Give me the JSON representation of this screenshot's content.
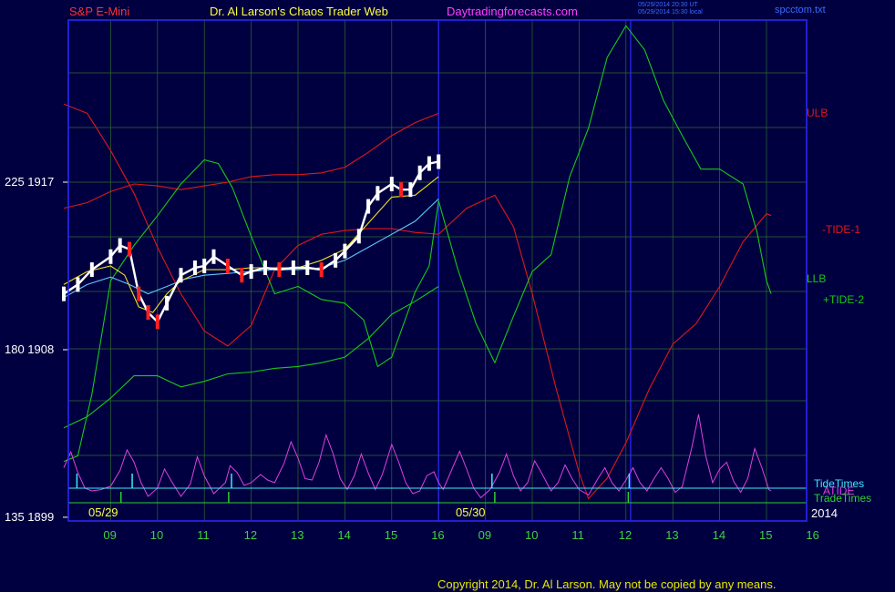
{
  "header": {
    "symbol": "S&P E-Mini",
    "title": "Dr. Al Larson's Chaos Trader Web",
    "site": "Daytradingforecasts.com",
    "stamp_ut": "05/29/2014 20:30 UT",
    "stamp_local": "05/29/2014 15:30 local",
    "file": "spcctom.txt"
  },
  "copyright": "Copyright 2014, Dr. Al Larson. May not be copied by any means.",
  "colors": {
    "background": "#000040",
    "grid": "#2e6a2e",
    "frame": "#2a2aff",
    "price": "#ffffff",
    "price_down": "#ff2020",
    "ulb": "#e01818",
    "llb": "#18c818",
    "ma": "#5ec8ff",
    "ma_fast": "#f0e020",
    "tide": "#e040e0",
    "tidetimes": "#40e8ff",
    "tradetimes": "#30d030"
  },
  "chart_data": {
    "type": "line",
    "y_axis_left": {
      "ticks": [
        {
          "value": 1917,
          "label": "225  1917"
        },
        {
          "value": 1908,
          "label": "180  1908"
        },
        {
          "value": 1899,
          "label": "135  1899"
        }
      ],
      "range": [
        1899,
        1925
      ]
    },
    "x_axis": {
      "hour_labels": [
        "09",
        "10",
        "11",
        "12",
        "13",
        "14",
        "15",
        "16",
        "09",
        "10",
        "11",
        "12",
        "13",
        "14",
        "15",
        "16"
      ],
      "date_labels": [
        "05/29",
        "05/30"
      ],
      "year_label": "2014"
    },
    "right_labels": [
      {
        "text": "ULB",
        "color": "#e01818"
      },
      {
        "text": "-TIDE-1",
        "color": "#e01818"
      },
      {
        "text": "LLB",
        "color": "#18c818"
      },
      {
        "text": "+TIDE-2",
        "color": "#18c818"
      },
      {
        "text": "TideTimes",
        "color": "#40e8ff"
      },
      {
        "text": "ATIDE",
        "color": "#e040e0"
      },
      {
        "text": "TradeTimes",
        "color": "#30d030"
      }
    ],
    "series": [
      {
        "key": "ulb",
        "points": [
          [
            8.0,
            1921.2
          ],
          [
            8.5,
            1920.7
          ],
          [
            9.0,
            1918.7
          ],
          [
            9.5,
            1916.4
          ],
          [
            10.0,
            1913.5
          ],
          [
            10.5,
            1911.0
          ],
          [
            11.0,
            1909.0
          ],
          [
            11.5,
            1908.2
          ],
          [
            12.0,
            1909.3
          ],
          [
            12.5,
            1912.3
          ],
          [
            13.0,
            1913.6
          ],
          [
            13.5,
            1914.2
          ],
          [
            14.0,
            1914.4
          ],
          [
            14.5,
            1914.5
          ],
          [
            15.0,
            1914.5
          ],
          [
            15.5,
            1914.3
          ],
          [
            16.0,
            1914.2
          ],
          [
            16.6,
            1915.6
          ],
          [
            17.2,
            1916.3
          ],
          [
            17.6,
            1914.6
          ],
          [
            18.0,
            1911.0
          ],
          [
            18.5,
            1906.0
          ],
          [
            19.0,
            1901.4
          ],
          [
            19.2,
            1900.0
          ],
          [
            19.6,
            1901.1
          ],
          [
            20.0,
            1903.0
          ],
          [
            20.5,
            1905.9
          ],
          [
            21.0,
            1908.3
          ],
          [
            21.5,
            1909.4
          ],
          [
            22.0,
            1911.4
          ],
          [
            22.5,
            1913.8
          ],
          [
            23.0,
            1915.3
          ],
          [
            23.1,
            1915.2
          ]
        ]
      },
      {
        "key": "ulb",
        "points": [
          [
            8.0,
            1915.6
          ],
          [
            8.5,
            1915.9
          ],
          [
            9.0,
            1916.5
          ],
          [
            9.5,
            1916.9
          ],
          [
            10.0,
            1916.8
          ],
          [
            10.5,
            1916.6
          ],
          [
            11.0,
            1916.8
          ],
          [
            11.5,
            1917.0
          ],
          [
            12.0,
            1917.3
          ],
          [
            12.5,
            1917.4
          ],
          [
            13.0,
            1917.4
          ],
          [
            13.5,
            1917.5
          ],
          [
            14.0,
            1917.8
          ],
          [
            14.5,
            1918.6
          ],
          [
            15.0,
            1919.5
          ],
          [
            15.5,
            1920.2
          ],
          [
            16.0,
            1920.7
          ]
        ]
      },
      {
        "key": "llb",
        "points": [
          [
            8.0,
            1903.8
          ],
          [
            8.5,
            1904.4
          ],
          [
            9.0,
            1905.4
          ],
          [
            9.5,
            1906.6
          ],
          [
            10.0,
            1906.6
          ],
          [
            10.5,
            1906.0
          ],
          [
            11.0,
            1906.3
          ],
          [
            11.5,
            1906.7
          ],
          [
            12.0,
            1906.8
          ],
          [
            12.5,
            1907.0
          ],
          [
            13.0,
            1907.1
          ],
          [
            13.5,
            1907.3
          ],
          [
            14.0,
            1907.6
          ],
          [
            14.5,
            1908.6
          ],
          [
            15.0,
            1909.9
          ],
          [
            15.5,
            1910.6
          ],
          [
            16.0,
            1911.4
          ]
        ]
      },
      {
        "key": "llb",
        "points": [
          [
            8.0,
            1902.0
          ],
          [
            8.3,
            1902.3
          ],
          [
            8.6,
            1905.6
          ],
          [
            9.0,
            1911.7
          ],
          [
            9.5,
            1913.6
          ],
          [
            10.0,
            1915.2
          ],
          [
            10.5,
            1916.9
          ],
          [
            11.0,
            1918.2
          ],
          [
            11.3,
            1918.0
          ],
          [
            11.6,
            1916.7
          ],
          [
            12.0,
            1914.1
          ],
          [
            12.5,
            1911.0
          ],
          [
            13.0,
            1911.4
          ],
          [
            13.5,
            1910.7
          ],
          [
            14.0,
            1910.5
          ],
          [
            14.4,
            1909.6
          ],
          [
            14.7,
            1907.1
          ],
          [
            15.0,
            1907.6
          ],
          [
            15.5,
            1911.1
          ],
          [
            15.8,
            1912.5
          ],
          [
            16.0,
            1916.0
          ],
          [
            16.4,
            1912.4
          ],
          [
            16.8,
            1909.4
          ],
          [
            17.2,
            1907.3
          ],
          [
            17.6,
            1909.8
          ],
          [
            18.0,
            1912.2
          ],
          [
            18.4,
            1913.1
          ],
          [
            18.8,
            1917.3
          ],
          [
            19.2,
            1919.9
          ],
          [
            19.6,
            1923.7
          ],
          [
            20.0,
            1925.4
          ],
          [
            20.4,
            1924.1
          ],
          [
            20.8,
            1921.4
          ],
          [
            21.2,
            1919.5
          ],
          [
            21.6,
            1917.7
          ],
          [
            22.0,
            1917.7
          ],
          [
            22.5,
            1916.9
          ],
          [
            22.8,
            1914.3
          ],
          [
            23.0,
            1911.7
          ],
          [
            23.1,
            1911.0
          ]
        ]
      },
      {
        "key": "ma",
        "points": [
          [
            8.0,
            1910.8
          ],
          [
            8.5,
            1911.5
          ],
          [
            9.0,
            1911.9
          ],
          [
            9.4,
            1911.5
          ],
          [
            9.8,
            1911.0
          ],
          [
            10.2,
            1911.4
          ],
          [
            10.6,
            1911.8
          ],
          [
            11.0,
            1912.0
          ],
          [
            11.5,
            1912.1
          ],
          [
            12.0,
            1912.2
          ],
          [
            12.5,
            1912.3
          ],
          [
            13.0,
            1912.3
          ],
          [
            13.5,
            1912.4
          ],
          [
            14.0,
            1912.8
          ],
          [
            14.5,
            1913.5
          ],
          [
            15.0,
            1914.2
          ],
          [
            15.5,
            1914.9
          ],
          [
            16.0,
            1916.1
          ]
        ]
      },
      {
        "key": "ma_fast",
        "points": [
          [
            8.0,
            1911.5
          ],
          [
            8.5,
            1912.2
          ],
          [
            9.0,
            1912.5
          ],
          [
            9.3,
            1912.0
          ],
          [
            9.6,
            1910.3
          ],
          [
            9.9,
            1910.0
          ],
          [
            10.2,
            1911.0
          ],
          [
            10.5,
            1911.7
          ],
          [
            11.0,
            1912.3
          ],
          [
            11.5,
            1912.3
          ],
          [
            12.0,
            1912.4
          ],
          [
            12.5,
            1912.4
          ],
          [
            13.0,
            1912.4
          ],
          [
            13.5,
            1912.8
          ],
          [
            14.0,
            1913.4
          ],
          [
            14.5,
            1914.8
          ],
          [
            15.0,
            1916.2
          ],
          [
            15.5,
            1916.3
          ],
          [
            16.0,
            1917.3
          ]
        ]
      },
      {
        "key": "price",
        "points": [
          [
            8.0,
            1911.0
          ],
          [
            8.3,
            1911.5
          ],
          [
            8.6,
            1912.3
          ],
          [
            9.0,
            1913.0
          ],
          [
            9.2,
            1913.6
          ],
          [
            9.4,
            1913.4
          ],
          [
            9.6,
            1911.0
          ],
          [
            9.8,
            1910.0
          ],
          [
            10.0,
            1909.5
          ],
          [
            10.2,
            1910.5
          ],
          [
            10.5,
            1912.0
          ],
          [
            10.8,
            1912.4
          ],
          [
            11.0,
            1912.5
          ],
          [
            11.2,
            1913.0
          ],
          [
            11.5,
            1912.5
          ],
          [
            11.8,
            1912.0
          ],
          [
            12.0,
            1912.2
          ],
          [
            12.3,
            1912.4
          ],
          [
            12.6,
            1912.3
          ],
          [
            12.9,
            1912.4
          ],
          [
            13.2,
            1912.4
          ],
          [
            13.5,
            1912.3
          ],
          [
            13.8,
            1912.8
          ],
          [
            14.0,
            1913.3
          ],
          [
            14.3,
            1914.1
          ],
          [
            14.5,
            1915.7
          ],
          [
            14.7,
            1916.4
          ],
          [
            15.0,
            1916.9
          ],
          [
            15.2,
            1916.6
          ],
          [
            15.4,
            1916.6
          ],
          [
            15.6,
            1917.5
          ],
          [
            15.8,
            1918.0
          ],
          [
            16.0,
            1918.1
          ]
        ]
      }
    ],
    "tide_curve": [
      [
        8.0,
        0.62
      ],
      [
        8.15,
        0.85
      ],
      [
        8.3,
        0.55
      ],
      [
        8.45,
        0.32
      ],
      [
        8.6,
        0.28
      ],
      [
        8.8,
        0.3
      ],
      [
        9.0,
        0.35
      ],
      [
        9.2,
        0.58
      ],
      [
        9.35,
        0.88
      ],
      [
        9.5,
        0.7
      ],
      [
        9.65,
        0.4
      ],
      [
        9.8,
        0.2
      ],
      [
        10.0,
        0.32
      ],
      [
        10.15,
        0.6
      ],
      [
        10.3,
        0.42
      ],
      [
        10.5,
        0.2
      ],
      [
        10.7,
        0.38
      ],
      [
        10.85,
        0.78
      ],
      [
        11.0,
        0.5
      ],
      [
        11.2,
        0.24
      ],
      [
        11.45,
        0.4
      ],
      [
        11.55,
        0.65
      ],
      [
        11.7,
        0.55
      ],
      [
        11.85,
        0.36
      ],
      [
        12.0,
        0.4
      ],
      [
        12.2,
        0.52
      ],
      [
        12.35,
        0.44
      ],
      [
        12.5,
        0.4
      ],
      [
        12.7,
        0.68
      ],
      [
        12.85,
        1.0
      ],
      [
        13.0,
        0.76
      ],
      [
        13.15,
        0.46
      ],
      [
        13.3,
        0.44
      ],
      [
        13.45,
        0.7
      ],
      [
        13.6,
        1.1
      ],
      [
        13.75,
        0.82
      ],
      [
        13.9,
        0.46
      ],
      [
        14.05,
        0.3
      ],
      [
        14.2,
        0.5
      ],
      [
        14.35,
        0.82
      ],
      [
        14.5,
        0.54
      ],
      [
        14.65,
        0.3
      ],
      [
        14.8,
        0.52
      ],
      [
        15.0,
        0.96
      ],
      [
        15.15,
        0.7
      ],
      [
        15.3,
        0.4
      ],
      [
        15.45,
        0.24
      ],
      [
        15.6,
        0.28
      ],
      [
        15.75,
        0.5
      ],
      [
        15.9,
        0.56
      ],
      [
        16.0,
        0.4
      ],
      [
        16.1,
        0.3
      ],
      [
        16.3,
        0.62
      ],
      [
        16.45,
        0.86
      ],
      [
        16.6,
        0.6
      ],
      [
        16.75,
        0.32
      ],
      [
        16.9,
        0.18
      ],
      [
        17.1,
        0.3
      ],
      [
        17.3,
        0.55
      ],
      [
        17.45,
        0.82
      ],
      [
        17.6,
        0.5
      ],
      [
        17.75,
        0.28
      ],
      [
        17.9,
        0.4
      ],
      [
        18.05,
        0.72
      ],
      [
        18.2,
        0.54
      ],
      [
        18.4,
        0.28
      ],
      [
        18.55,
        0.4
      ],
      [
        18.7,
        0.66
      ],
      [
        18.85,
        0.46
      ],
      [
        19.0,
        0.3
      ],
      [
        19.2,
        0.22
      ],
      [
        19.4,
        0.46
      ],
      [
        19.55,
        0.62
      ],
      [
        19.7,
        0.4
      ],
      [
        19.85,
        0.28
      ],
      [
        20.0,
        0.44
      ],
      [
        20.15,
        0.62
      ],
      [
        20.3,
        0.4
      ],
      [
        20.45,
        0.28
      ],
      [
        20.6,
        0.46
      ],
      [
        20.75,
        0.62
      ],
      [
        20.9,
        0.46
      ],
      [
        21.05,
        0.26
      ],
      [
        21.2,
        0.34
      ],
      [
        21.4,
        0.9
      ],
      [
        21.55,
        1.4
      ],
      [
        21.7,
        0.8
      ],
      [
        21.85,
        0.4
      ],
      [
        22.0,
        0.6
      ],
      [
        22.15,
        0.7
      ],
      [
        22.3,
        0.42
      ],
      [
        22.45,
        0.26
      ],
      [
        22.6,
        0.46
      ],
      [
        22.75,
        0.9
      ],
      [
        22.9,
        0.62
      ],
      [
        23.05,
        0.3
      ],
      [
        23.1,
        0.28
      ]
    ],
    "tide_times": [
      8.28,
      9.46,
      11.58,
      17.14,
      20.07
    ],
    "trade_times": [
      9.22,
      11.52,
      17.2,
      20.05
    ]
  }
}
